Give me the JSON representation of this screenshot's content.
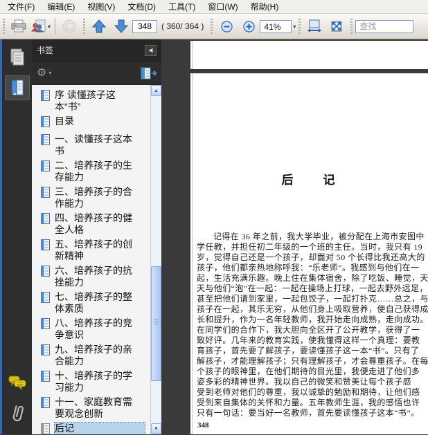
{
  "menu": {
    "items": [
      "文件(F)",
      "编辑(E)",
      "视图(V)",
      "文档(D)",
      "工具(T)",
      "窗口(W)",
      "帮助(H)"
    ]
  },
  "toolbar": {
    "page_value": "348",
    "page_count": "( 360/ 364 )",
    "zoom_value": "41%",
    "find_placeholder": "查找",
    "icons": {
      "printer": "printer",
      "review": "document-with-people",
      "share_disabled": "send-disabled",
      "prev_page": "blue-up-arrow",
      "next_page": "blue-down-arrow",
      "zoom_out": "minus-circle",
      "zoom_in": "plus-circle",
      "combo_caret": "▾",
      "fit_width": "page-width-arrows",
      "fit_page": "page-expand-arrows"
    }
  },
  "sidebar": {
    "panel_title": "书签",
    "collapse_glyph": "◀",
    "gear_glyph": "⚙",
    "gear_caret": "▾",
    "scroll_up_glyph": "▲",
    "scroll_down_glyph": "▼",
    "bookmarks": [
      {
        "label": "序 读懂孩子这本“书”",
        "selected": false
      },
      {
        "label": "目录",
        "selected": false
      },
      {
        "label": "一、读懂孩子这本书",
        "selected": false
      },
      {
        "label": "二、培养孩子的生存能力",
        "selected": false
      },
      {
        "label": "三、培养孩子的合作能力",
        "selected": false
      },
      {
        "label": "四、培养孩子的健全人格",
        "selected": false
      },
      {
        "label": "五、培养孩子的创新精神",
        "selected": false
      },
      {
        "label": "六、培养孩子的抗挫能力",
        "selected": false
      },
      {
        "label": "七、培养孩子的整体素质",
        "selected": false
      },
      {
        "label": "八、培养孩子的竞争意识",
        "selected": false
      },
      {
        "label": "九、培养孩子的亲合能力",
        "selected": false
      },
      {
        "label": "十、培养孩子的学习能力",
        "selected": false
      },
      {
        "label": "十一、家庭教育需要观念创新",
        "selected": false
      },
      {
        "label": "后记",
        "selected": true
      }
    ]
  },
  "document": {
    "title": "后　　记",
    "lines": [
      "记得在 36 年之前，我大学毕业，被分配在上海市安图中",
      "学任教，并担任初二年级的一个班的主任。当时，我只有 19",
      "岁，觉得自己还是一个孩子，却面对 50 个长得比我还高大的",
      "孩子，他们都亲热地称呼我：“乐老师”。我感到与他们在一",
      "起，生活充满乐趣。晚上住在集体宿舍，除了吃饭、睡觉，天",
      "天与他们“泡”在一起：一起在操场上打球，一起去野外远足，",
      "甚至把他们请到家里，一起包饺子，一起打扑克……总之，与",
      "孩子在一起，其乐无穷，从他们身上吸取营养，使自己获得成",
      "长和提升，作为一名年轻教师，我开始走向成熟，走向成功。",
      "在同学们的合作下，我大胆向全区开了公开教学，获得了一",
      "致好评。几年来的教育实践，使我懂得这样一个真理：要教",
      "育孩子，首先要了解孩子，要读懂孩子这一本“书”。只有了",
      "解孩子，才能理解孩子；只有理解孩子，才会尊重孩子。在每",
      "个孩子的眼神里，在他们期待的目光里，我便走进了他们多",
      "姿多彩的精神世界。我以自己的微笑和赞美让每个孩子感",
      "受到老师对他们的尊重，我以诚挚的勉励和期待，让他们感",
      "受到来自集体的关怀和力量。五年教师生涯，我的感悟也许",
      "只有一句话：要当好一名教师，首先要读懂孩子这本“书”。"
    ],
    "page_number": "348"
  },
  "colors": {
    "selection_blue": "#b7d4ec",
    "toolbar_blue": "#3f7fc4",
    "panel_dark": "#2d2d2d",
    "window_border_blue": "#3a66b0",
    "doc_background": "#3a3a3a"
  }
}
